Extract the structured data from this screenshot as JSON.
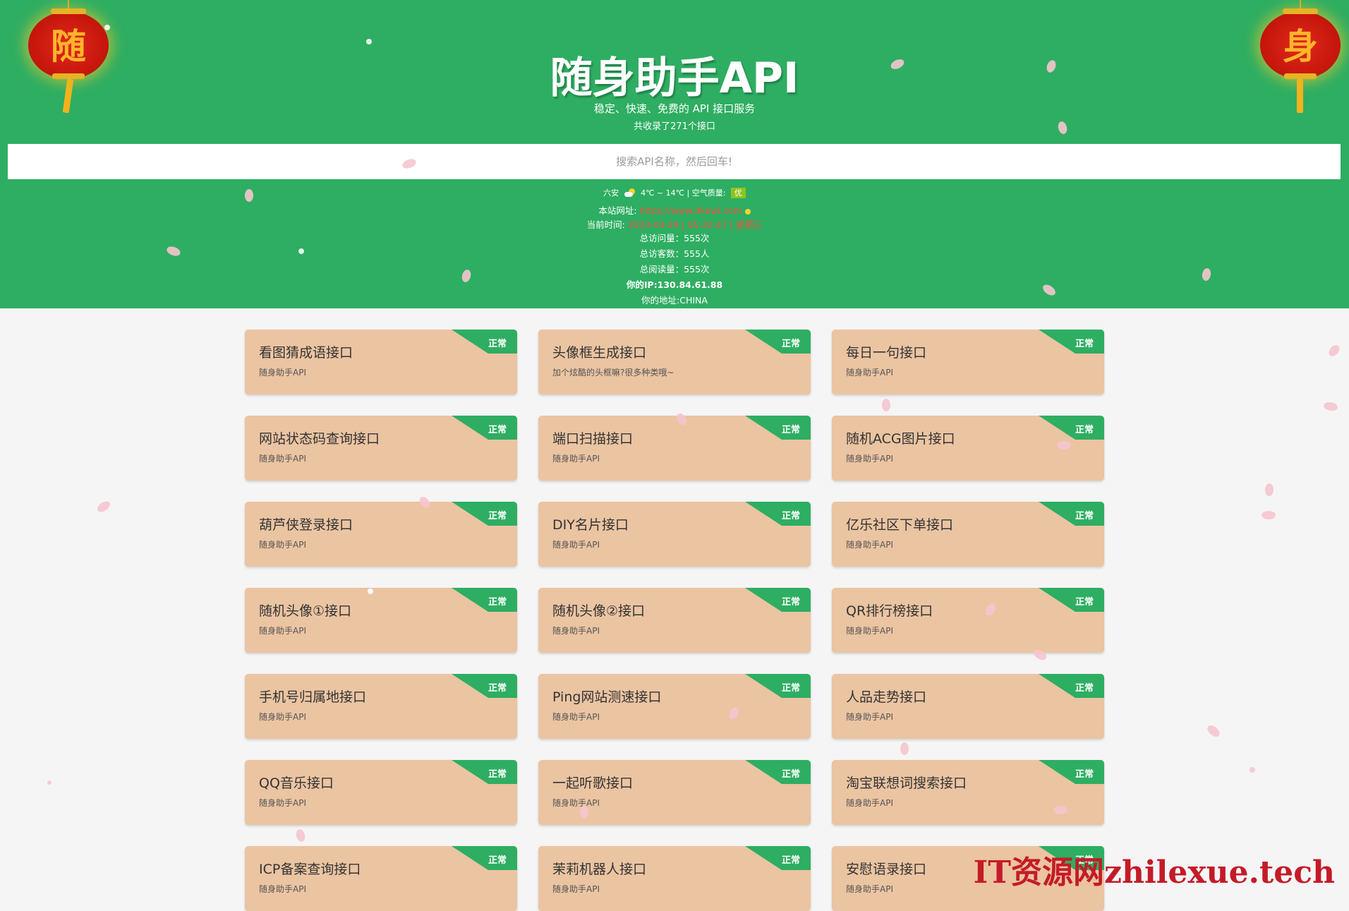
{
  "header": {
    "title": "随身助手API",
    "subtitle": "稳定、快速、免费的 API 接口服务",
    "count_text": "共收录了271个接口",
    "search_placeholder": "搜索API名称，然后回车!",
    "bg_color": "#2eae62"
  },
  "lanterns": {
    "left_char": "随",
    "right_char": "身"
  },
  "info": {
    "city": "六安",
    "weather_text": "4℃ ~ 14℃ | 空气质量:",
    "air_quality": "优",
    "site_label": "本站网址:",
    "site_url": "https://www.dkewl.com",
    "time_label": "当前时间:",
    "time_value": "2023-03-29 | 05:32:47 | 星期三",
    "total_visits": "总访问量：555次",
    "total_visitors": "总访客数：555人",
    "total_reads": "总阅读量：555次",
    "ip": "你的IP:130.84.61.88",
    "location": "你的地址:CHINA"
  },
  "cards": [
    {
      "name": "看图猜成语接口",
      "desc": "随身助手API",
      "status": "正常"
    },
    {
      "name": "头像框生成接口",
      "desc": "加个炫酷的头框嘛?很多种类哦~",
      "status": "正常"
    },
    {
      "name": "每日一句接口",
      "desc": "随身助手API",
      "status": "正常"
    },
    {
      "name": "网站状态码查询接口",
      "desc": "随身助手API",
      "status": "正常"
    },
    {
      "name": "端口扫描接口",
      "desc": "随身助手API",
      "status": "正常"
    },
    {
      "name": "随机ACG图片接口",
      "desc": "随身助手API",
      "status": "正常"
    },
    {
      "name": "葫芦侠登录接口",
      "desc": "随身助手API",
      "status": "正常"
    },
    {
      "name": "DIY名片接口",
      "desc": "随身助手API",
      "status": "正常"
    },
    {
      "name": "亿乐社区下单接口",
      "desc": "随身助手API",
      "status": "正常"
    },
    {
      "name": "随机头像①接口",
      "desc": "随身助手API",
      "status": "正常"
    },
    {
      "name": "随机头像②接口",
      "desc": "随身助手API",
      "status": "正常"
    },
    {
      "name": "QR排行榜接口",
      "desc": "随身助手API",
      "status": "正常"
    },
    {
      "name": "手机号归属地接口",
      "desc": "随身助手API",
      "status": "正常"
    },
    {
      "name": "Ping网站测速接口",
      "desc": "随身助手API",
      "status": "正常"
    },
    {
      "name": "人品走势接口",
      "desc": "随身助手API",
      "status": "正常"
    },
    {
      "name": "QQ音乐接口",
      "desc": "随身助手API",
      "status": "正常"
    },
    {
      "name": "一起听歌接口",
      "desc": "随身助手API",
      "status": "正常"
    },
    {
      "name": "淘宝联想词搜索接口",
      "desc": "随身助手API",
      "status": "正常"
    },
    {
      "name": "ICP备案查询接口",
      "desc": "随身助手API",
      "status": "正常"
    },
    {
      "name": "茉莉机器人接口",
      "desc": "随身助手API",
      "status": "正常"
    },
    {
      "name": "安慰语录接口",
      "desc": "随身助手API",
      "status": "正常"
    }
  ],
  "watermark": "IT资源网zhilexue.tech"
}
